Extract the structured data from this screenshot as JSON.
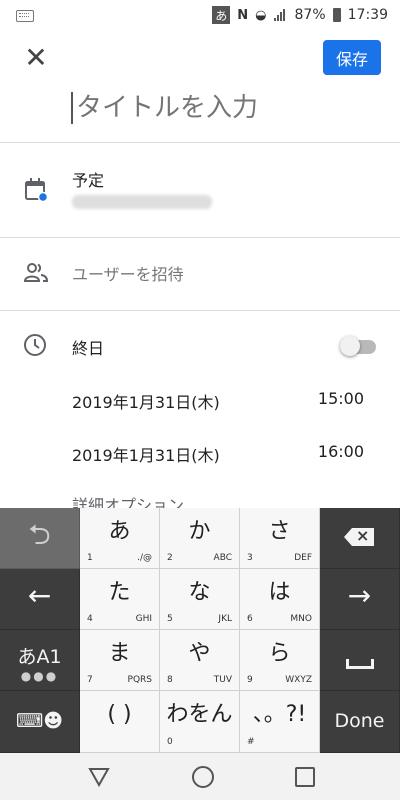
{
  "status_bar": {
    "ime_badge": "あ",
    "nfc_icon": "N",
    "battery": "87%",
    "time": "17:39"
  },
  "top_bar": {
    "close_icon": "✕",
    "save_label": "保存"
  },
  "title_input": {
    "placeholder": "タイトルを入力"
  },
  "calendar": {
    "label": "予定",
    "account": "blurred-account",
    "dot_color": "#1a73e8"
  },
  "guests": {
    "label": "ユーザーを招待"
  },
  "all_day": {
    "label": "終日",
    "enabled": false
  },
  "start": {
    "date": "2019年1月31日(木)",
    "time": "15:00"
  },
  "end": {
    "date": "2019年1月31日(木)",
    "time": "16:00"
  },
  "options_label": "詳細オプション",
  "keyboard": {
    "keys": [
      {
        "char": "あ",
        "num": "1",
        "sub": "./@"
      },
      {
        "char": "か",
        "num": "2",
        "sub": "ABC"
      },
      {
        "char": "さ",
        "num": "3",
        "sub": "DEF"
      },
      {
        "char": "た",
        "num": "4",
        "sub": "GHI"
      },
      {
        "char": "な",
        "num": "5",
        "sub": "JKL"
      },
      {
        "char": "は",
        "num": "6",
        "sub": "MNO"
      },
      {
        "char": "ま",
        "num": "7",
        "sub": "PQRS"
      },
      {
        "char": "や",
        "num": "8",
        "sub": "TUV"
      },
      {
        "char": "ら",
        "num": "9",
        "sub": "WXYZ"
      },
      {
        "char": "( )",
        "num": "",
        "sub": ""
      },
      {
        "char": "わをん",
        "num": "0",
        "sub": ""
      },
      {
        "char": "、。?!",
        "num": "#",
        "sub": ""
      }
    ],
    "undo_icon": "⮌",
    "left_arrow": "←",
    "right_arrow": "→",
    "mode_label": "あA1",
    "mode_dots": "●●●",
    "emoji_icon": "⌨☻",
    "done_label": "Done"
  }
}
